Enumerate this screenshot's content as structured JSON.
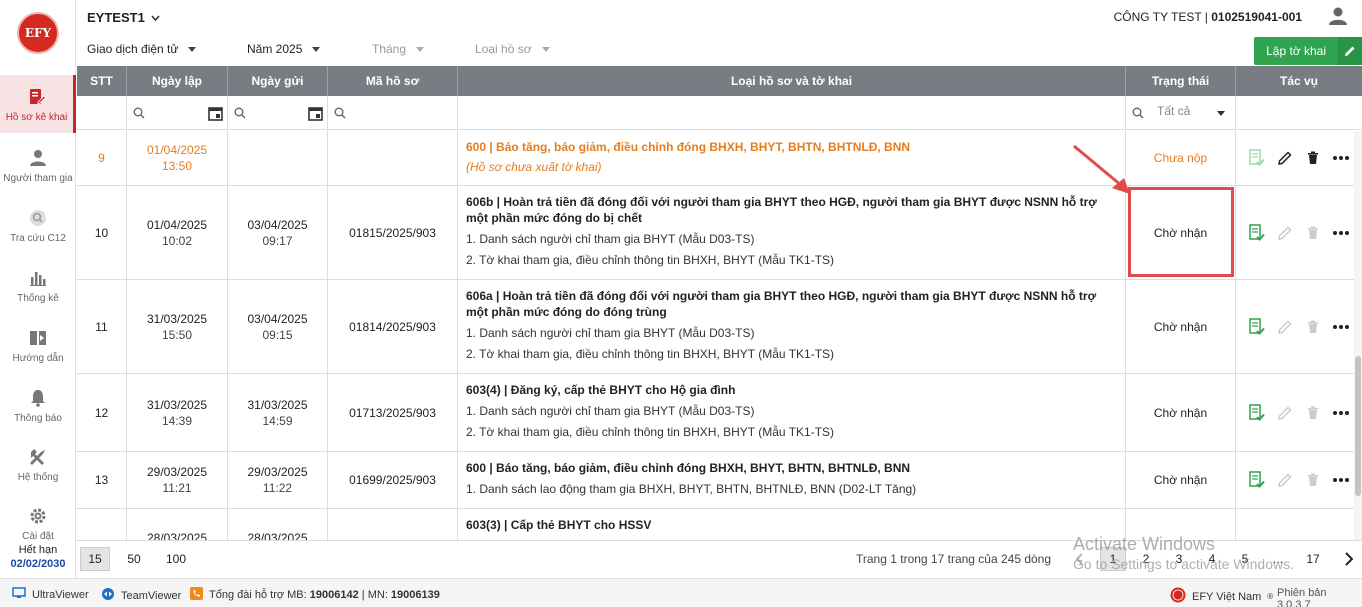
{
  "logo": "EFY",
  "sidebar": {
    "items": [
      {
        "label": "Hồ sơ kê khai",
        "icon": "document-edit-icon",
        "active": true
      },
      {
        "label": "Người tham gia",
        "icon": "person-icon"
      },
      {
        "label": "Tra cứu C12",
        "icon": "search-circle-icon"
      },
      {
        "label": "Thống kê",
        "icon": "bar-chart-icon"
      },
      {
        "label": "Hướng dẫn",
        "icon": "book-icon"
      },
      {
        "label": "Thông báo",
        "icon": "bell-icon"
      },
      {
        "label": "Hệ thống",
        "icon": "tools-icon"
      },
      {
        "label": "Cài đặt",
        "icon": "gear-icon"
      }
    ],
    "expire_label": "Hết hạn",
    "expire_date": "02/02/2030"
  },
  "header": {
    "company_selector": "EYTEST1",
    "company_name": "CÔNG TY TEST | ",
    "tax_code": "0102519041-001"
  },
  "filters": {
    "type": "Giao dịch điện tử",
    "year": "Năm 2025",
    "month": "Tháng",
    "record_type": "Loại hồ sơ",
    "create_button": "Lập tờ khai"
  },
  "table": {
    "columns": [
      "STT",
      "Ngày lập",
      "Ngày gửi",
      "Mã hồ sơ",
      "Loại hồ sơ và tờ khai",
      "Trạng thái",
      "Tác vụ"
    ],
    "status_filter": "Tất cả",
    "rows": [
      {
        "stt": "9",
        "created_date": "01/04/2025",
        "created_time": "13:50",
        "sent_date": "",
        "sent_time": "",
        "code": "",
        "title": "600 | Báo tăng, báo giảm, điều chỉnh đóng BHXH, BHYT, BHTN, BHTNLĐ, BNN",
        "items": [],
        "note": "(Hồ sơ chưa xuất tờ khai)",
        "status": "Chưa nộp",
        "pending": true
      },
      {
        "stt": "10",
        "created_date": "01/04/2025",
        "created_time": "10:02",
        "sent_date": "03/04/2025",
        "sent_time": "09:17",
        "code": "01815/2025/903",
        "title": "606b | Hoàn trả tiền đã đóng đối với người tham gia BHYT theo HGĐ, người tham gia BHYT được NSNN hỗ trợ một phần mức đóng do bị chết",
        "items": [
          "1. Danh sách người chỉ tham gia BHYT (Mẫu D03-TS)",
          "2. Tờ khai tham gia, điều chỉnh thông tin BHXH, BHYT (Mẫu TK1-TS)"
        ],
        "note": "",
        "status": "Chờ nhận",
        "pending": false
      },
      {
        "stt": "11",
        "created_date": "31/03/2025",
        "created_time": "15:50",
        "sent_date": "03/04/2025",
        "sent_time": "09:15",
        "code": "01814/2025/903",
        "title": "606a | Hoàn trả tiền đã đóng đối với người tham gia BHYT theo HGĐ, người tham gia BHYT được NSNN hỗ trợ một phần mức đóng do đóng trùng",
        "items": [
          "1. Danh sách người chỉ tham gia BHYT (Mẫu D03-TS)",
          "2. Tờ khai tham gia, điều chỉnh thông tin BHXH, BHYT (Mẫu TK1-TS)"
        ],
        "note": "",
        "status": "Chờ nhận",
        "pending": false
      },
      {
        "stt": "12",
        "created_date": "31/03/2025",
        "created_time": "14:39",
        "sent_date": "31/03/2025",
        "sent_time": "14:59",
        "code": "01713/2025/903",
        "title": "603(4) | Đăng ký, cấp thẻ BHYT cho Hộ gia đình",
        "items": [
          "1. Danh sách người chỉ tham gia BHYT (Mẫu D03-TS)",
          "2. Tờ khai tham gia, điều chỉnh thông tin BHXH, BHYT (Mẫu TK1-TS)"
        ],
        "note": "",
        "status": "Chờ nhận",
        "pending": false
      },
      {
        "stt": "13",
        "created_date": "29/03/2025",
        "created_time": "11:21",
        "sent_date": "29/03/2025",
        "sent_time": "11:22",
        "code": "01699/2025/903",
        "title": "600 | Báo tăng, báo giảm, điều chỉnh đóng BHXH, BHYT, BHTN, BHTNLĐ, BNN",
        "items": [
          "1. Danh sách lao động tham gia BHXH, BHYT, BHTN, BHTNLĐ, BNN (D02-LT Tăng)"
        ],
        "note": "",
        "status": "Chờ nhận",
        "pending": false
      },
      {
        "stt": "",
        "created_date": "28/03/2025",
        "created_time": "",
        "sent_date": "28/03/2025",
        "sent_time": "",
        "code": "",
        "title": "603(3) | Cấp thẻ BHYT cho HSSV",
        "items": [],
        "note": "",
        "status": "",
        "pending": false
      }
    ]
  },
  "pager": {
    "sizes": [
      "15",
      "50",
      "100"
    ],
    "info": "Trang 1 trong 17 trang của 245 dòng",
    "pages": [
      "1",
      "2",
      "3",
      "4",
      "5",
      "...",
      "17"
    ]
  },
  "footer": {
    "ultraviewer": "UltraViewer",
    "teamviewer": "TeamViewer",
    "hotline_label": "Tổng đài hỗ trợ MB: ",
    "hotline_mb": "19006142",
    "hotline_sep": " | MN: ",
    "hotline_mn": "19006139",
    "brand": "EFY Việt Nam",
    "version": "Phiên bản 3.0.3.7"
  },
  "watermark": {
    "line1": "Activate Windows",
    "line2": "Go to Settings to activate Windows."
  }
}
